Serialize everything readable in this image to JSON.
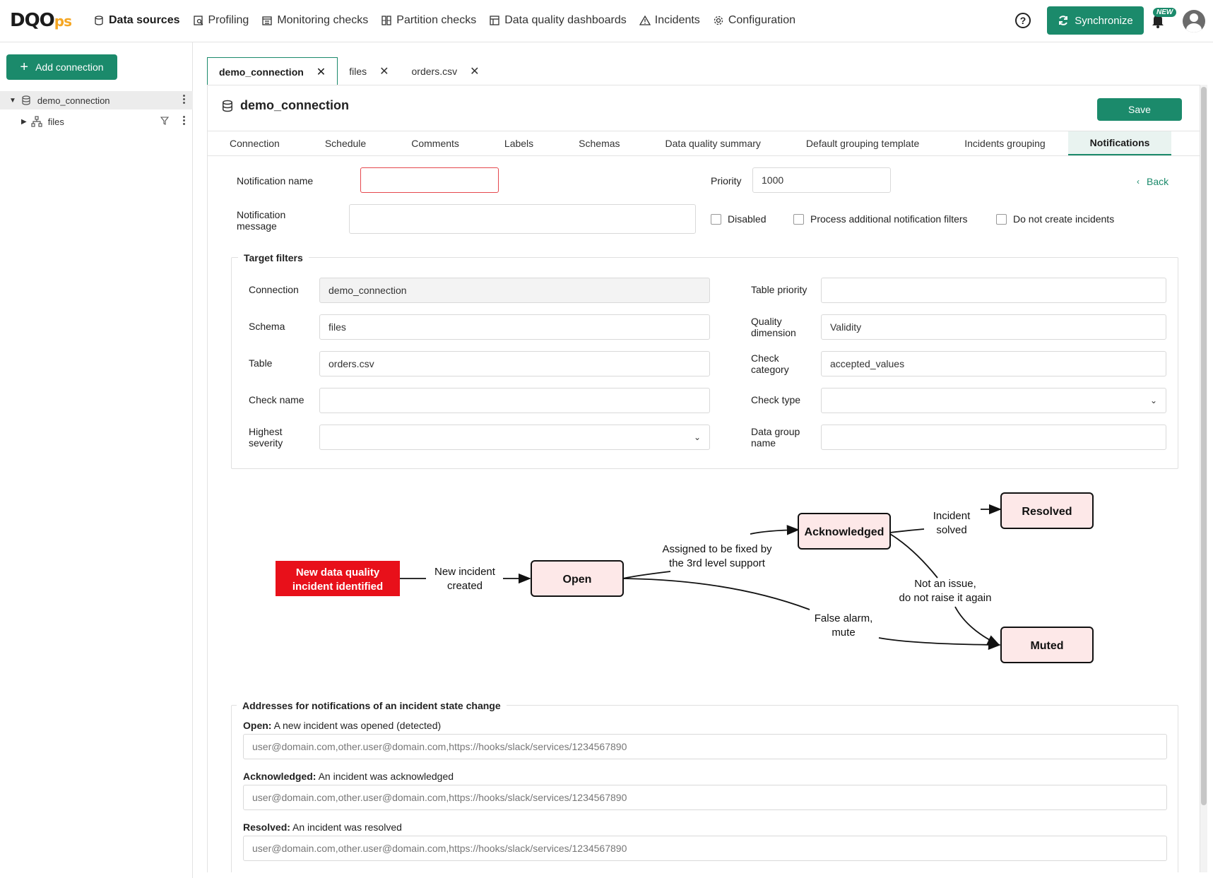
{
  "app": {
    "logo_main": "DQO",
    "logo_suffix": "ps",
    "nav": [
      {
        "label": "Data sources",
        "icon": "database-icon"
      },
      {
        "label": "Profiling",
        "icon": "profiling-icon"
      },
      {
        "label": "Monitoring checks",
        "icon": "calendar-icon"
      },
      {
        "label": "Partition checks",
        "icon": "partition-icon"
      },
      {
        "label": "Data quality dashboards",
        "icon": "dashboard-icon"
      },
      {
        "label": "Incidents",
        "icon": "warning-icon"
      },
      {
        "label": "Configuration",
        "icon": "gear-icon"
      }
    ],
    "help_label": "?",
    "sync_label": "Synchronize",
    "new_badge": "NEW",
    "colors": {
      "accent": "#1b8a6b",
      "error": "#e5484d",
      "incident_red": "#e8101a",
      "state_fill": "#fde8e8"
    }
  },
  "sidebar": {
    "add_connection": "Add connection",
    "tree": [
      {
        "label": "demo_connection",
        "icon": "database-icon",
        "expanded": true
      },
      {
        "label": "files",
        "icon": "schema-icon",
        "expanded": false
      }
    ]
  },
  "tabs": [
    {
      "label": "demo_connection",
      "active": true
    },
    {
      "label": "files",
      "active": false
    },
    {
      "label": "orders.csv",
      "active": false
    }
  ],
  "panel": {
    "title": "demo_connection",
    "save_label": "Save",
    "subtabs": [
      "Connection",
      "Schedule",
      "Comments",
      "Labels",
      "Schemas",
      "Data quality summary",
      "Default grouping template",
      "Incidents grouping",
      "Notifications"
    ],
    "active_subtab": "Notifications"
  },
  "form": {
    "notification_name_label": "Notification name",
    "notification_name_value": "",
    "priority_label": "Priority",
    "priority_value": "1000",
    "back_label": "Back",
    "message_label_1": "Notification",
    "message_label_2": "message",
    "message_value": "",
    "disabled_label": "Disabled",
    "process_filters_label": "Process additional notification filters",
    "no_incidents_label": "Do not create incidents"
  },
  "target_filters": {
    "legend": "Target filters",
    "connection_label": "Connection",
    "connection_value": "demo_connection",
    "schema_label": "Schema",
    "schema_value": "files",
    "table_label": "Table",
    "table_value": "orders.csv",
    "check_name_label": "Check name",
    "check_name_value": "",
    "severity_label_1": "Highest",
    "severity_label_2": "severity",
    "severity_value": "",
    "table_priority_label": "Table priority",
    "table_priority_value": "",
    "quality_dim_label_1": "Quality",
    "quality_dim_label_2": "dimension",
    "quality_dim_value": "Validity",
    "check_cat_label_1": "Check",
    "check_cat_label_2": "category",
    "check_cat_value": "accepted_values",
    "check_type_label": "Check type",
    "check_type_value": "",
    "data_group_label_1": "Data group",
    "data_group_label_2": "name",
    "data_group_value": ""
  },
  "diagram": {
    "start_1": "New data quality",
    "start_2": "incident identified",
    "edge_created_1": "New incident",
    "edge_created_2": "created",
    "state_open": "Open",
    "edge_assigned_1": "Assigned to be fixed by",
    "edge_assigned_2": "the 3rd level support",
    "state_ack": "Acknowledged",
    "edge_solved_1": "Incident",
    "edge_solved_2": "solved",
    "state_resolved": "Resolved",
    "edge_notissue_1": "Not an issue,",
    "edge_notissue_2": "do not raise it again",
    "edge_false_1": "False alarm,",
    "edge_false_2": "mute",
    "state_muted": "Muted"
  },
  "addresses": {
    "legend": "Addresses for notifications of an incident state change",
    "items": [
      {
        "state": "Open:",
        "desc": " A new incident was opened (detected)",
        "value": "user@domain.com,other.user@domain.com,https://hooks/slack/services/1234567890"
      },
      {
        "state": "Acknowledged:",
        "desc": " An incident was acknowledged",
        "value": "user@domain.com,other.user@domain.com,https://hooks/slack/services/1234567890"
      },
      {
        "state": "Resolved:",
        "desc": " An incident was resolved",
        "value": "user@domain.com,other.user@domain.com,https://hooks/slack/services/1234567890"
      }
    ]
  }
}
